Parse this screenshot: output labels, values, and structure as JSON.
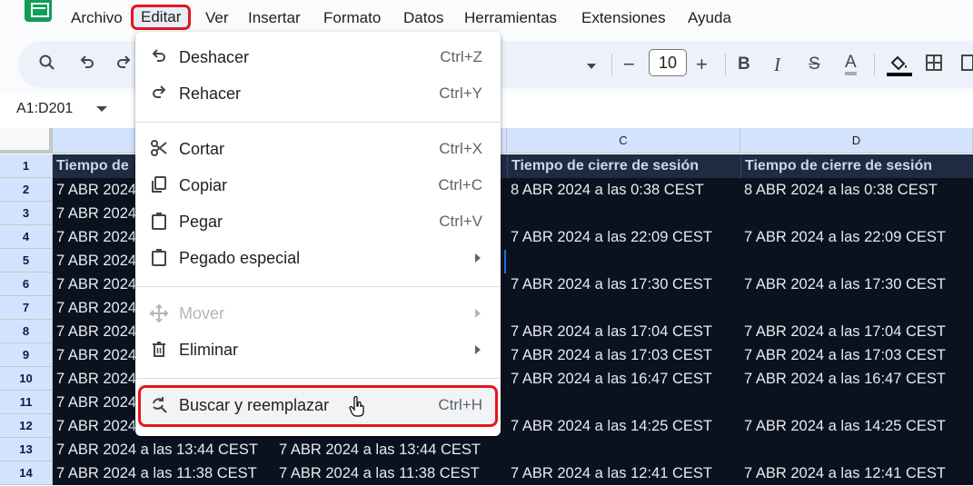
{
  "menubar": {
    "items": [
      "Archivo",
      "Editar",
      "Ver",
      "Insertar",
      "Formato",
      "Datos",
      "Herramientas",
      "Extensiones",
      "Ayuda"
    ]
  },
  "toolbar": {
    "font_size": "10",
    "font_size_minus": "−",
    "font_size_plus": "+",
    "bold": "B",
    "italic": "I",
    "strike": "S",
    "text_color": "A"
  },
  "formula": {
    "name_box": "A1:D201"
  },
  "columns": [
    "C",
    "D"
  ],
  "rows": [
    {
      "num": "1",
      "a": "Tiempo de",
      "c": "Tiempo de cierre de sesión",
      "d": "Tiempo de cierre de sesión"
    },
    {
      "num": "2",
      "a": "7 ABR 2024",
      "c": "8 ABR 2024 a las 0:38 CEST",
      "d": "8 ABR 2024 a las 0:38 CEST"
    },
    {
      "num": "3",
      "a": "7 ABR 2024",
      "c": "",
      "d": ""
    },
    {
      "num": "4",
      "a": "7 ABR 2024",
      "c": "7 ABR 2024 a las 22:09 CEST",
      "d": "7 ABR 2024 a las 22:09 CEST"
    },
    {
      "num": "5",
      "a": "7 ABR 2024",
      "c": "",
      "d": ""
    },
    {
      "num": "6",
      "a": "7 ABR 2024",
      "c": "7 ABR 2024 a las 17:30 CEST",
      "d": "7 ABR 2024 a las 17:30 CEST"
    },
    {
      "num": "7",
      "a": "7 ABR 2024",
      "c": "",
      "d": ""
    },
    {
      "num": "8",
      "a": "7 ABR 2024",
      "c": "7 ABR 2024 a las 17:04 CEST",
      "d": "7 ABR 2024 a las 17:04 CEST"
    },
    {
      "num": "9",
      "a": "7 ABR 2024",
      "c": "7 ABR 2024 a las 17:03 CEST",
      "d": "7 ABR 2024 a las 17:03 CEST"
    },
    {
      "num": "10",
      "a": "7 ABR 2024",
      "c": "7 ABR 2024 a las 16:47 CEST",
      "d": "7 ABR 2024 a las 16:47 CEST"
    },
    {
      "num": "11",
      "a": "7 ABR 2024",
      "c": "",
      "d": ""
    },
    {
      "num": "12",
      "a": "7 ABR 2024",
      "c": "7 ABR 2024 a las 14:25 CEST",
      "d": "7 ABR 2024 a las 14:25 CEST"
    },
    {
      "num": "13",
      "a": "7 ABR 2024 a las 13:44 CEST",
      "b": "7 ABR 2024 a las 13:44 CEST",
      "c": "",
      "d": ""
    },
    {
      "num": "14",
      "a": "7 ABR 2024 a las 11:38 CEST",
      "b": "7 ABR 2024 a las 11:38 CEST",
      "c": "7 ABR 2024 a las 12:41 CEST",
      "d": "7 ABR 2024 a las 12:41 CEST"
    }
  ],
  "edit_menu": {
    "undo": {
      "label": "Deshacer",
      "shortcut": "Ctrl+Z",
      "icon": "undo-icon"
    },
    "redo": {
      "label": "Rehacer",
      "shortcut": "Ctrl+Y",
      "icon": "redo-icon"
    },
    "cut": {
      "label": "Cortar",
      "shortcut": "Ctrl+X",
      "icon": "scissors-icon"
    },
    "copy": {
      "label": "Copiar",
      "shortcut": "Ctrl+C",
      "icon": "copy-icon"
    },
    "paste": {
      "label": "Pegar",
      "shortcut": "Ctrl+V",
      "icon": "clipboard-icon"
    },
    "paste_special": {
      "label": "Pegado especial",
      "icon": "clipboard-icon"
    },
    "move": {
      "label": "Mover",
      "icon": "move-icon"
    },
    "delete": {
      "label": "Eliminar",
      "icon": "trash-icon"
    },
    "find_replace": {
      "label": "Buscar y reemplazar",
      "shortcut": "Ctrl+H",
      "icon": "find-replace-icon"
    }
  },
  "colors": {
    "highlight_outline": "#e3161b",
    "cell_background": "#0a1220",
    "header_background": "#d3e3fd"
  }
}
